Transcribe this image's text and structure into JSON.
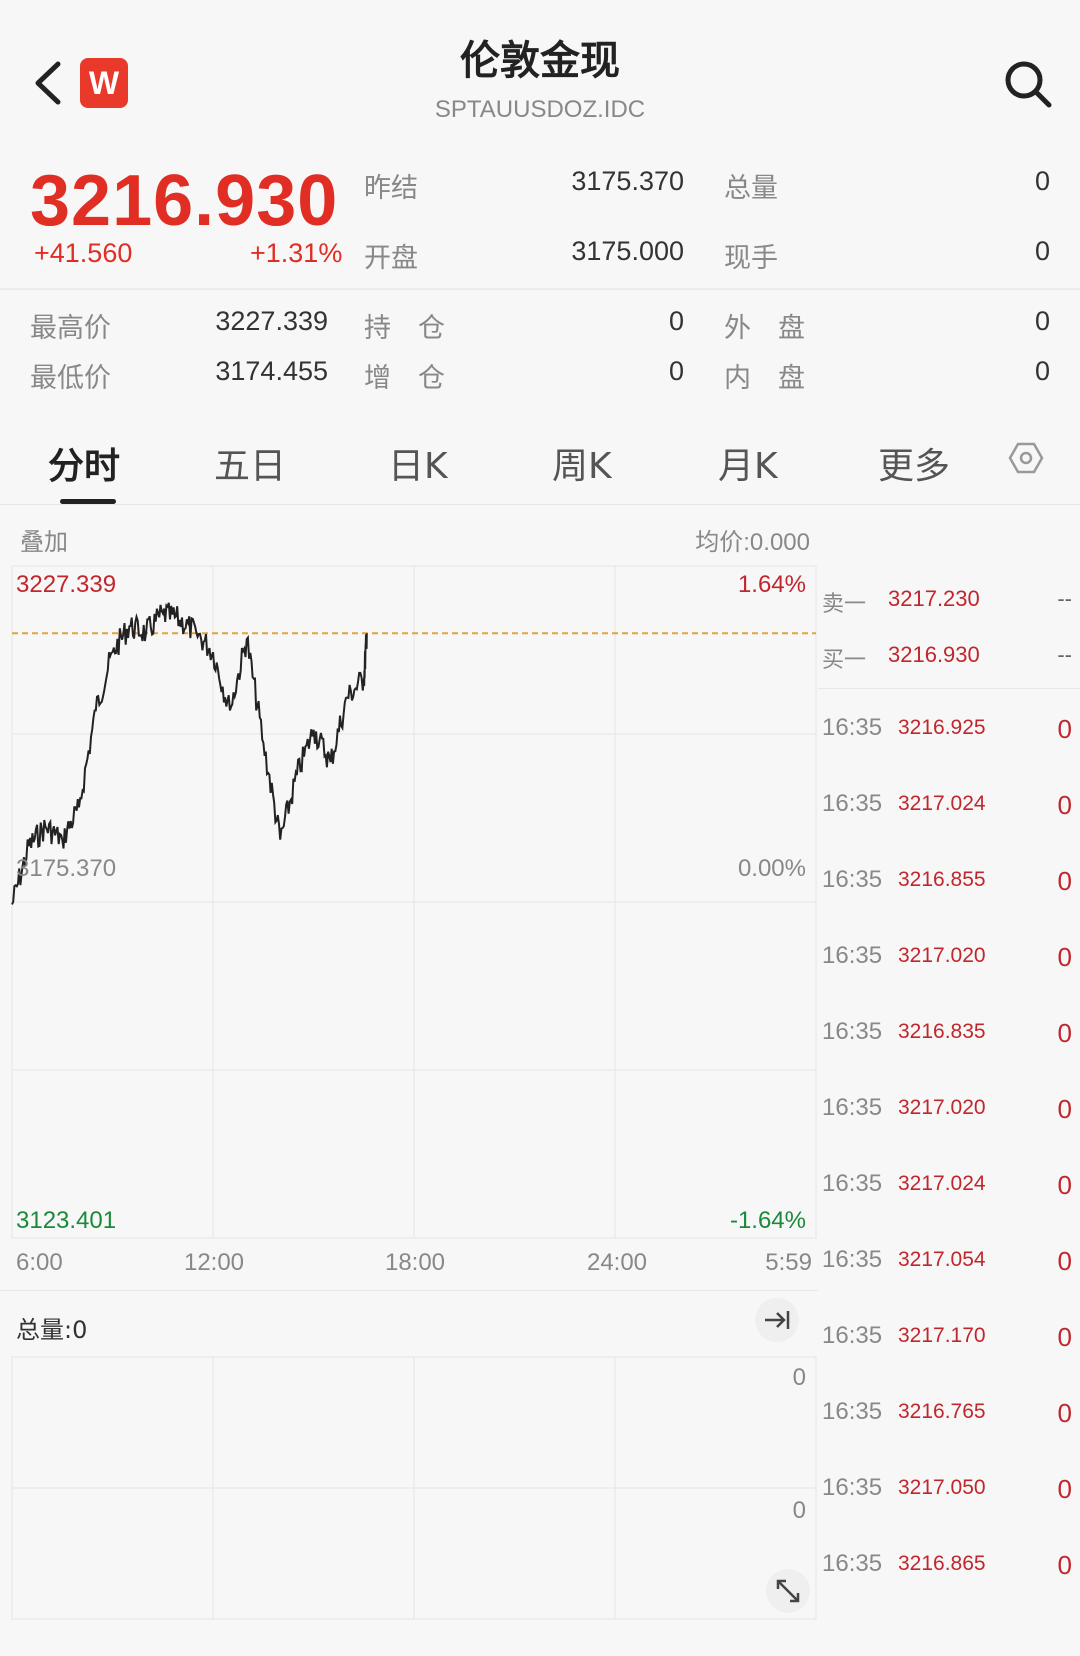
{
  "header": {
    "title": "伦敦金现",
    "code": "SPTAUUSDOZ.IDC",
    "logo_letter": "W"
  },
  "quote": {
    "price": "3216.930",
    "change": "+41.560",
    "change_pct": "+1.31%",
    "prev_settle_label": "昨结",
    "prev_settle": "3175.370",
    "open_label": "开盘",
    "open": "3175.000",
    "total_vol_label": "总量",
    "total_vol": "0",
    "current_hand_label": "现手",
    "current_hand": "0"
  },
  "stats": {
    "high_label": "最高价",
    "high": "3227.339",
    "low_label": "最低价",
    "low": "3174.455",
    "open_interest_label": "持　仓",
    "open_interest": "0",
    "oi_change_label": "增　仓",
    "oi_change": "0",
    "outer_label": "外　盘",
    "outer": "0",
    "inner_label": "内　盘",
    "inner": "0"
  },
  "tabs": [
    "分时",
    "五日",
    "日K",
    "周K",
    "月K",
    "更多"
  ],
  "chart": {
    "overlay_label": "叠加",
    "avg_price": "均价:0.000",
    "top_price": "3227.339",
    "top_pct": "1.64%",
    "mid_price": "3175.370",
    "mid_pct": "0.00%",
    "bottom_price": "3123.401",
    "bottom_pct": "-1.64%",
    "x_labels": [
      "6:00",
      "12:00",
      "18:00",
      "24:00",
      "5:59"
    ],
    "current_price": 3216.93,
    "colors": {
      "up": "#c0272d",
      "down": "#1a8a3a",
      "line": "#222222",
      "ref": "#e3a23b"
    }
  },
  "chart_data": {
    "type": "line",
    "title": "",
    "xlabel": "",
    "ylabel": "",
    "x_ticks": [
      "6:00",
      "12:00",
      "18:00",
      "24:00",
      "5:59"
    ],
    "ylim": [
      3123.401,
      3227.339
    ],
    "reference": 3175.37,
    "series": [
      {
        "x": [
          "6:00",
          "6:30",
          "7:00",
          "7:30",
          "8:00",
          "8:30",
          "9:00",
          "9:30",
          "10:00",
          "10:30",
          "11:00",
          "11:30",
          "12:00",
          "12:30",
          "13:00",
          "13:30",
          "14:00",
          "14:30",
          "15:00",
          "15:30",
          "16:00",
          "16:30",
          "16:35"
        ],
        "values": [
          3175.0,
          3184.0,
          3187.0,
          3185.0,
          3190.0,
          3205.0,
          3214.0,
          3218.0,
          3217.0,
          3220.0,
          3219.0,
          3217.0,
          3214.0,
          3205.0,
          3216.0,
          3200.0,
          3185.0,
          3195.0,
          3202.0,
          3197.0,
          3207.0,
          3210.0,
          3216.93
        ]
      }
    ]
  },
  "volume": {
    "label": "总量:0",
    "axis_top": "0",
    "axis_mid": "0"
  },
  "orderbook": [
    {
      "label": "卖一",
      "price": "3217.230",
      "vol": "--"
    },
    {
      "label": "买一",
      "price": "3216.930",
      "vol": "--"
    }
  ],
  "trades": [
    {
      "time": "16:35",
      "price": "3216.925",
      "vol": "0"
    },
    {
      "time": "16:35",
      "price": "3217.024",
      "vol": "0"
    },
    {
      "time": "16:35",
      "price": "3216.855",
      "vol": "0"
    },
    {
      "time": "16:35",
      "price": "3217.020",
      "vol": "0"
    },
    {
      "time": "16:35",
      "price": "3216.835",
      "vol": "0"
    },
    {
      "time": "16:35",
      "price": "3217.020",
      "vol": "0"
    },
    {
      "time": "16:35",
      "price": "3217.024",
      "vol": "0"
    },
    {
      "time": "16:35",
      "price": "3217.054",
      "vol": "0"
    },
    {
      "time": "16:35",
      "price": "3217.170",
      "vol": "0"
    },
    {
      "time": "16:35",
      "price": "3216.765",
      "vol": "0"
    },
    {
      "time": "16:35",
      "price": "3217.050",
      "vol": "0"
    },
    {
      "time": "16:35",
      "price": "3216.865",
      "vol": "0"
    }
  ]
}
